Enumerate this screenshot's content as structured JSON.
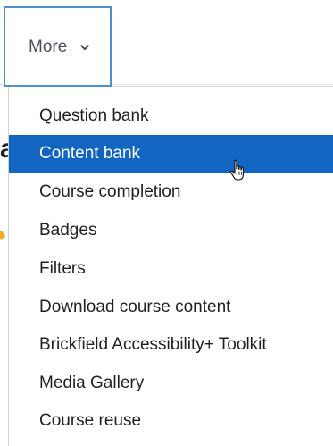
{
  "nav": {
    "more_label": "More"
  },
  "menu": {
    "items": [
      {
        "label": "Question bank",
        "active": false
      },
      {
        "label": "Content bank",
        "active": true
      },
      {
        "label": "Course completion",
        "active": false
      },
      {
        "label": "Badges",
        "active": false
      },
      {
        "label": "Filters",
        "active": false
      },
      {
        "label": "Download course content",
        "active": false
      },
      {
        "label": "Brickfield Accessibility+ Toolkit",
        "active": false
      },
      {
        "label": "Media Gallery",
        "active": false
      },
      {
        "label": "Course reuse",
        "active": false
      }
    ]
  },
  "colors": {
    "active_background": "#1266c2",
    "active_text": "#ffffff",
    "tab_border": "#4f8fd0",
    "text": "#1d2125",
    "muted_text": "#4a4f55"
  },
  "icons": {
    "chevron": "chevron-down-icon",
    "cursor": "hand-pointer-cursor-icon"
  }
}
